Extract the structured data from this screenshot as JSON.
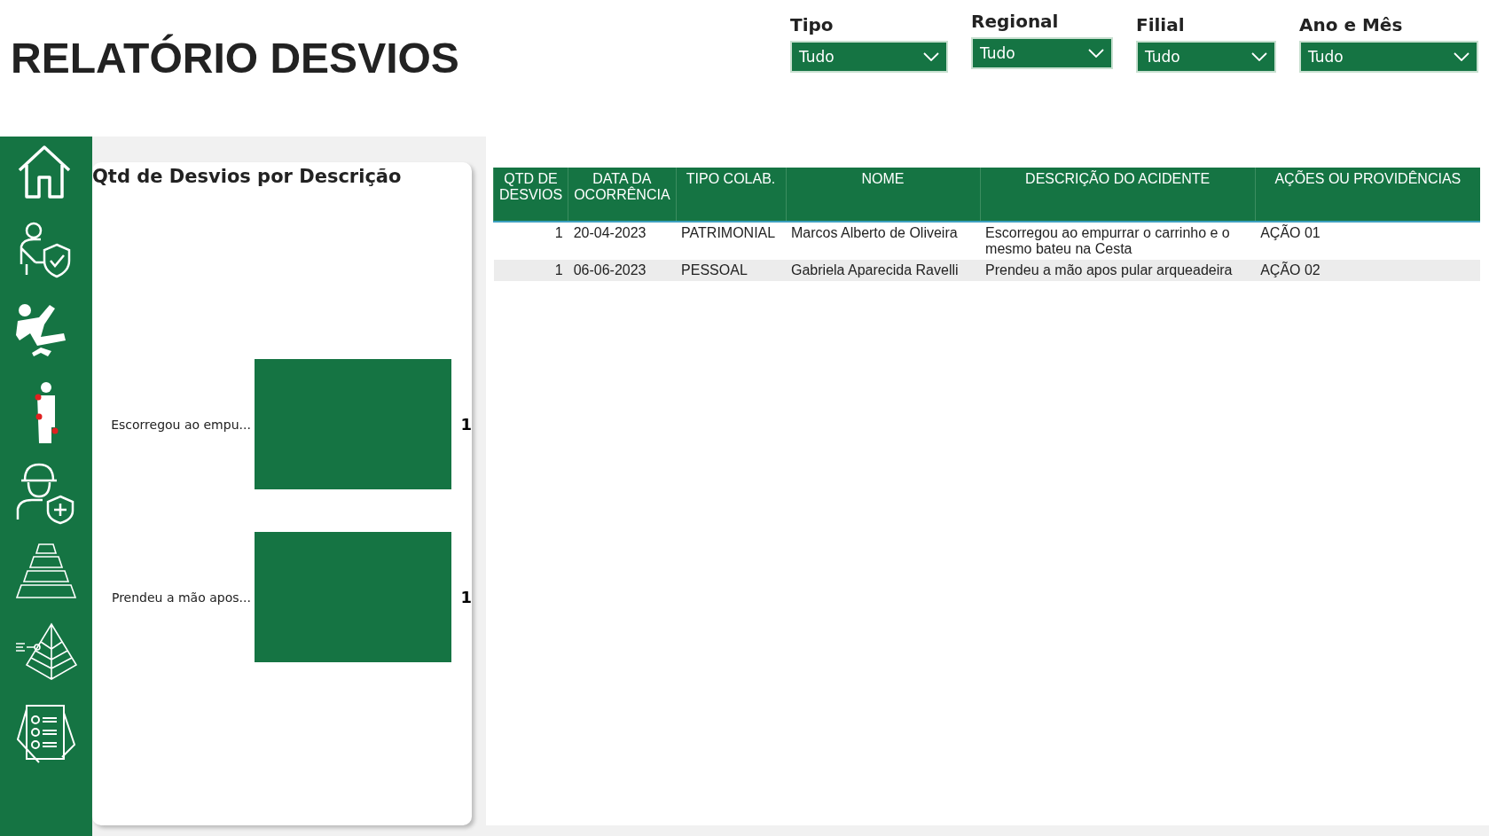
{
  "title": "RELATÓRIO DESVIOS",
  "filters": [
    {
      "label": "Tipo",
      "value": "Tudo"
    },
    {
      "label": "Regional",
      "value": "Tudo"
    },
    {
      "label": "Filial",
      "value": "Tudo"
    },
    {
      "label": "Ano e Mês",
      "value": "Tudo"
    }
  ],
  "chart": {
    "title": "Qtd de Desvios por Descrição",
    "chart_data": {
      "type": "bar",
      "orientation": "horizontal",
      "categories": [
        "Escorregou ao empu...",
        "Prendeu a mão apos..."
      ],
      "values": [
        1,
        1
      ],
      "data_labels": true
    }
  },
  "table": {
    "columns": [
      "QTD DE DESVIOS",
      "DATA DA OCORRÊNCIA",
      "TIPO COLAB.",
      "NOME",
      "DESCRIÇÃO DO ACIDENTE",
      "AÇÕES OU PROVIDÊNCIAS"
    ],
    "rows": [
      [
        "1",
        "20-04-2023",
        "PATRIMONIAL",
        "Marcos Alberto de Oliveira",
        "Escorregou ao empurrar o carrinho e o mesmo bateu na Cesta",
        "AÇÃO 01"
      ],
      [
        "1",
        "06-06-2023",
        "PESSOAL",
        "Gabriela Aparecida Ravelli",
        "Prendeu a mão apos pular arqueadeira",
        "AÇÃO 02"
      ]
    ]
  }
}
